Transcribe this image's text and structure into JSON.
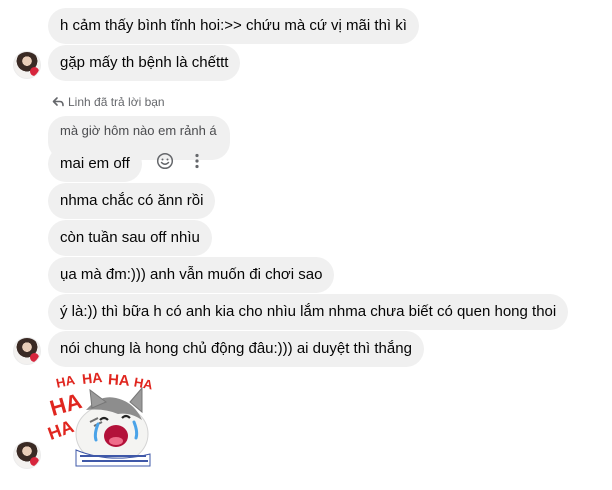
{
  "messages": [
    {
      "text": "h cảm thấy bình tĩnh hoi:>> chứu mà cứ vị mãi thì kì"
    },
    {
      "text": "gặp mấy th bệnh là chếttt"
    },
    {
      "text": "mai em off"
    },
    {
      "text": "nhma chắc có ănn rồi"
    },
    {
      "text": "còn tuần sau off nhìu"
    },
    {
      "text": "ụa mà đm:))) anh vẫn muốn đi chơi sao"
    },
    {
      "text": "ý là:)) thì bữa h có anh kia cho nhìu lắm nhma chưa biết có quen hong thoi"
    },
    {
      "text": "nói chung là hong chủ động đâu:))) ai duyệt thì thắng"
    }
  ],
  "reply": {
    "label": "Linh đã trả lời bạn",
    "quoted_text": "mà giờ hôm nào em rảnh á"
  },
  "sticker": {
    "text": [
      "HA",
      "HA",
      "HA",
      "HA",
      "HA",
      "HA"
    ],
    "color": "#e0261f"
  },
  "icons": {
    "reply": "reply-arrow-icon",
    "react": "smiley-icon",
    "more": "more-vertical-icon"
  },
  "colors": {
    "bubble": "#f0f0f0",
    "secondary_text": "#65676b"
  }
}
